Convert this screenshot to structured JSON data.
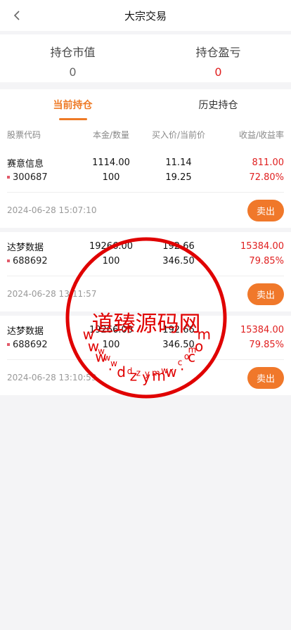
{
  "header": {
    "title": "大宗交易"
  },
  "summary": {
    "market_value_label": "持仓市值",
    "market_value": "0",
    "profit_label": "持仓盈亏",
    "profit": "0"
  },
  "tabs": [
    {
      "label": "当前持仓",
      "active": true
    },
    {
      "label": "历史持仓",
      "active": false
    }
  ],
  "table_headers": [
    "股票代码",
    "本金/数量",
    "买入价/当前价",
    "收益/收益率"
  ],
  "positions": [
    {
      "name": "赛意信息",
      "code": "300687",
      "principal": "1114.00",
      "quantity": "100",
      "buy_price": "11.14",
      "current_price": "19.25",
      "profit": "811.00",
      "profit_rate": "72.80%",
      "time": "2024-06-28 15:07:10",
      "sell_label": "卖出"
    },
    {
      "name": "达梦数据",
      "code": "688692",
      "principal": "19266.00",
      "quantity": "100",
      "buy_price": "192.66",
      "current_price": "346.50",
      "profit": "15384.00",
      "profit_rate": "79.85%",
      "time": "2024-06-28 13:11:57",
      "sell_label": "卖出"
    },
    {
      "name": "达梦数据",
      "code": "688692",
      "principal": "19266.00",
      "quantity": "100",
      "buy_price": "192.66",
      "current_price": "346.50",
      "profit": "15384.00",
      "profit_rate": "79.85%",
      "time": "2024-06-28 13:10:59",
      "sell_label": "卖出"
    }
  ],
  "watermark": {
    "center_text": "道臻源码网",
    "ring_top_chars": [
      "w",
      "w",
      "w",
      ".",
      "d",
      "z",
      "y",
      "m",
      "w",
      ".",
      "c",
      "o",
      "m"
    ],
    "ring_bottom_chars": [
      "w",
      "w",
      "w",
      ".",
      "d",
      "z",
      "y",
      "m",
      "w",
      ".",
      "c",
      "o",
      "m"
    ],
    "color": "#e00000"
  },
  "colors": {
    "accent": "#ee7a26",
    "loss_profit_red": "#e02020"
  }
}
